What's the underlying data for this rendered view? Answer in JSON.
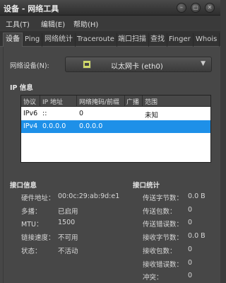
{
  "window": {
    "title": "设备 - 网络工具"
  },
  "menu": [
    {
      "label": "工具(T)"
    },
    {
      "label": "编辑(E)"
    },
    {
      "label": "帮助(H)"
    }
  ],
  "tabs": [
    {
      "label": "设备"
    },
    {
      "label": "Ping"
    },
    {
      "label": "网络统计"
    },
    {
      "label": "Traceroute"
    },
    {
      "label": "端口扫描"
    },
    {
      "label": "查找"
    },
    {
      "label": "Finger"
    },
    {
      "label": "Whois"
    }
  ],
  "device": {
    "label": "网络设备(N):",
    "selected": "以太网卡 (eth0)"
  },
  "ip_info": {
    "title": "IP 信息",
    "columns": [
      "协议",
      "IP 地址",
      "网络掩码/前缀",
      "广播",
      "范围"
    ],
    "rows": [
      {
        "protocol": "IPv6",
        "address": "::",
        "netmask": "0",
        "broadcast": "",
        "scope": "未知"
      },
      {
        "protocol": "IPv4",
        "address": "0.0.0.0",
        "netmask": "0.0.0.0",
        "broadcast": "",
        "scope": ""
      }
    ]
  },
  "interface_info": {
    "title": "接口信息",
    "hw_label": "硬件地址：",
    "hw_value": "00:0c:29:ab:9d:e1",
    "multicast_label": "多播：",
    "multicast_value": "已启用",
    "mtu_label": "MTU：",
    "mtu_value": "1500",
    "speed_label": "链接速度：",
    "speed_value": "不可用",
    "state_label": "状态：",
    "state_value": "不活动"
  },
  "interface_stats": {
    "title": "接口统计",
    "tx_bytes_label": "传送字节数：",
    "tx_bytes_value": "0.0 B",
    "tx_packets_label": "传送包数：",
    "tx_packets_value": "0",
    "tx_errors_label": "传送错误数：",
    "tx_errors_value": "0",
    "rx_bytes_label": "接收字节数：",
    "rx_bytes_value": "0.0 B",
    "rx_packets_label": "接收包数：",
    "rx_packets_value": "0",
    "rx_errors_label": "接收错误数：",
    "rx_errors_value": "0",
    "collisions_label": "冲突：",
    "collisions_value": "0"
  }
}
